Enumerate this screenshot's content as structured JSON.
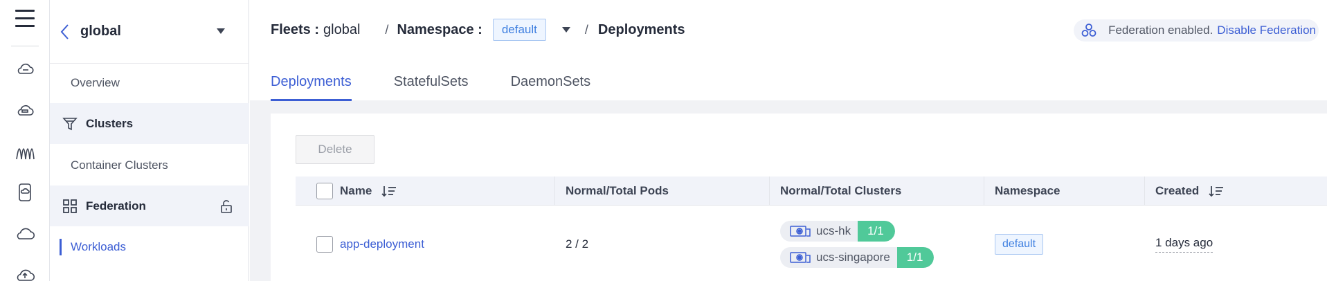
{
  "subnav": {
    "title": "global",
    "items": [
      {
        "label": "Overview"
      },
      {
        "label": "Clusters"
      },
      {
        "label": "Container Clusters"
      },
      {
        "label": "Federation"
      },
      {
        "label": "Workloads"
      }
    ]
  },
  "breadcrumb": {
    "fleets_label": "Fleets :",
    "fleets_value": "global",
    "namespace_label": "Namespace :",
    "namespace_value": "default",
    "page": "Deployments"
  },
  "federation": {
    "status_text": "Federation enabled.",
    "action_link": "Disable Federation"
  },
  "tabs": [
    {
      "label": "Deployments",
      "active": true
    },
    {
      "label": "StatefulSets",
      "active": false
    },
    {
      "label": "DaemonSets",
      "active": false
    }
  ],
  "toolbar": {
    "delete_label": "Delete"
  },
  "table": {
    "columns": [
      "Name",
      "Normal/Total Pods",
      "Normal/Total Clusters",
      "Namespace",
      "Created"
    ],
    "rows": [
      {
        "name": "app-deployment",
        "pods": "2 / 2",
        "clusters": [
          {
            "name": "ucs-hk",
            "count": "1/1"
          },
          {
            "name": "ucs-singapore",
            "count": "1/1"
          }
        ],
        "namespace": "default",
        "created": "1 days ago"
      }
    ]
  },
  "colors": {
    "accent": "#3c5ed4",
    "success": "#50c999",
    "tag_blue": "#3e7fe0"
  },
  "icons": [
    "menu-icon",
    "cloud-icon",
    "cloud-disk-icon",
    "waves-icon",
    "phone-icon",
    "cloud-outline-icon",
    "back-chevron-icon",
    "caret-down-icon",
    "filter-icon",
    "grid-icon",
    "unlock-icon",
    "federation-icon",
    "sort-icon",
    "cluster-icon"
  ]
}
